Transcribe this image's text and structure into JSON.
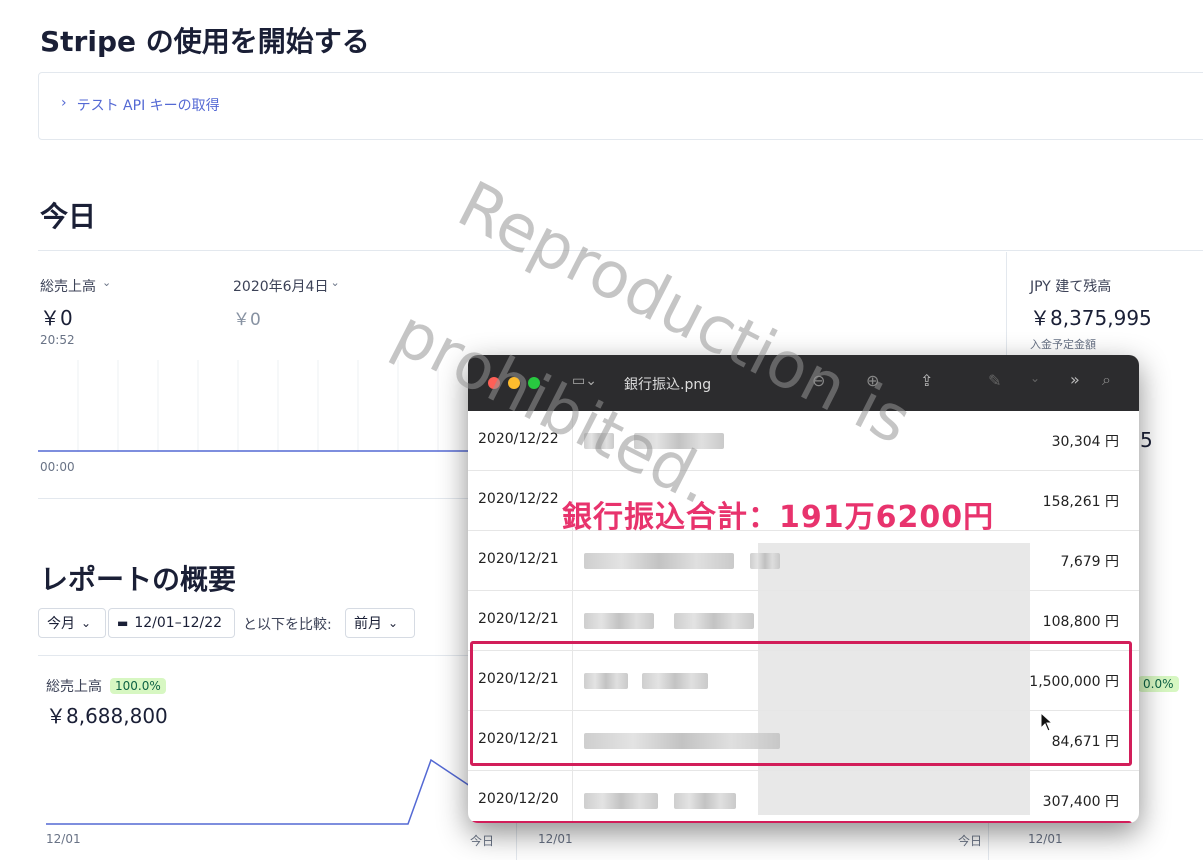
{
  "header": {
    "title": "Stripe の使用を開始する"
  },
  "getting_started": {
    "link_label": "テスト API キーの取得"
  },
  "today": {
    "title": "今日",
    "gross_label": "総売上高",
    "gross_value": "￥0",
    "gross_time": "20:52",
    "compare_label": "2020年6月4日",
    "compare_value": "￥0",
    "axis_start": "00:00",
    "balance_label": "JPY 建て残高",
    "balance_value": "￥8,375,995",
    "balance_sub": "入金予定金額",
    "partial_value": "5"
  },
  "report": {
    "title": "レポートの概要",
    "period_select": "今月",
    "date_range": "12/01–12/22",
    "compare_text": "と以下を比較:",
    "compare_select": "前月",
    "gross_label": "総売上高",
    "gross_badge": "100.0%",
    "gross_value": "￥8,688,800",
    "right_badge": "0.0%",
    "axis": [
      "12/01",
      "今日",
      "12/01",
      "今日",
      "12/01"
    ]
  },
  "preview": {
    "title": "銀行振込.png",
    "annotation": "銀行振込合計：191万6200円",
    "rows": [
      {
        "date": "2020/12/22",
        "amount": "30,304 円"
      },
      {
        "date": "2020/12/22",
        "amount": "158,261 円"
      },
      {
        "date": "2020/12/21",
        "amount": "7,679 円"
      },
      {
        "date": "2020/12/21",
        "amount": "108,800 円"
      },
      {
        "date": "2020/12/21",
        "amount": "1,500,000 円"
      },
      {
        "date": "2020/12/21",
        "amount": "84,671 円"
      },
      {
        "date": "2020/12/20",
        "amount": "307,400 円"
      }
    ]
  },
  "watermark": {
    "line1": "Reproduction is",
    "line2": "prohibited."
  },
  "colors": {
    "accent": "#635bff",
    "highlight": "#d21e5a",
    "annotation": "#e8336d",
    "badge_bg": "#d7f7c2"
  }
}
